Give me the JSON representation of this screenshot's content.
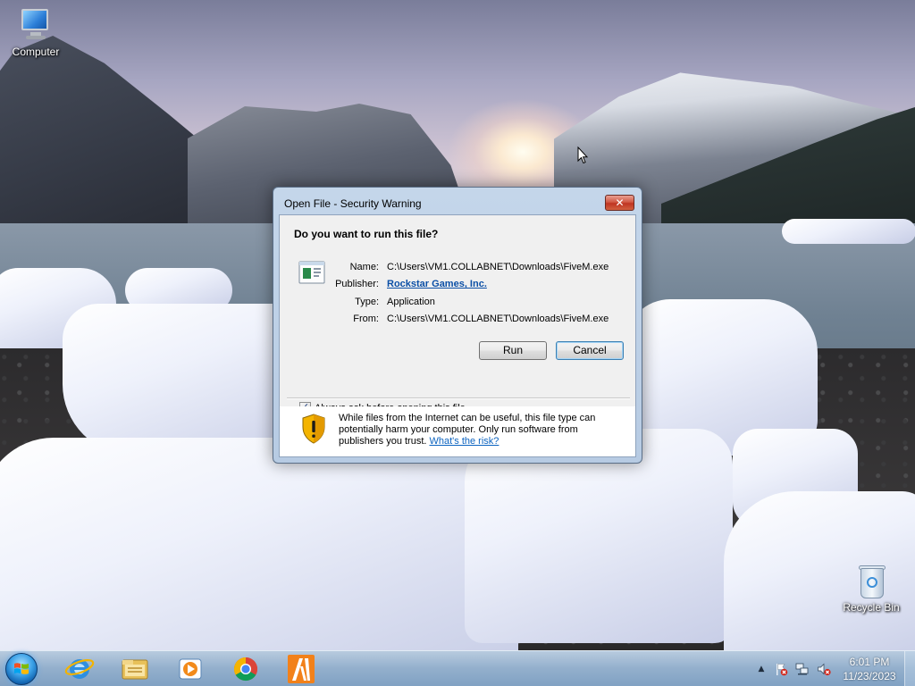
{
  "desktop": {
    "icons": [
      {
        "label": "Computer",
        "icon": "computer-icon"
      },
      {
        "label": "Recycle Bin",
        "icon": "recycle-bin-icon"
      }
    ]
  },
  "dialog": {
    "title": "Open File - Security Warning",
    "close_symbol": "✕",
    "question": "Do you want to run this file?",
    "fields": [
      {
        "label": "Name:",
        "value": "C:\\Users\\VM1.COLLABNET\\Downloads\\FiveM.exe"
      },
      {
        "label": "Publisher:",
        "value": "Rockstar Games, Inc."
      },
      {
        "label": "Type:",
        "value": "Application"
      },
      {
        "label": "From:",
        "value": "C:\\Users\\VM1.COLLABNET\\Downloads\\FiveM.exe"
      }
    ],
    "run_label": "Run",
    "cancel_label": "Cancel",
    "checkbox_label": "Always ask before opening this file",
    "checkbox_checked": true,
    "checkbox_mark": "✓",
    "warning_text": "While files from the Internet can be useful, this file type can potentially harm your computer. Only run software from publishers you trust.",
    "warning_link": "What's the risk?"
  },
  "taskbar": {
    "pinned": [
      {
        "name": "internet-explorer",
        "icon": "internet-explorer-icon"
      },
      {
        "name": "windows-explorer",
        "icon": "folder-icon"
      },
      {
        "name": "media-player",
        "icon": "media-player-icon"
      },
      {
        "name": "google-chrome",
        "icon": "chrome-icon"
      },
      {
        "name": "fivem",
        "icon": "fivem-icon"
      }
    ],
    "tray_expand_symbol": "▲",
    "clock": {
      "time": "6:01 PM",
      "date": "11/23/2023"
    }
  },
  "colors": {
    "link": "#0b4fa6",
    "dialog_frame": "#b7cbe3",
    "close_button": "#c7432e",
    "taskbar": "#96b4d2"
  }
}
